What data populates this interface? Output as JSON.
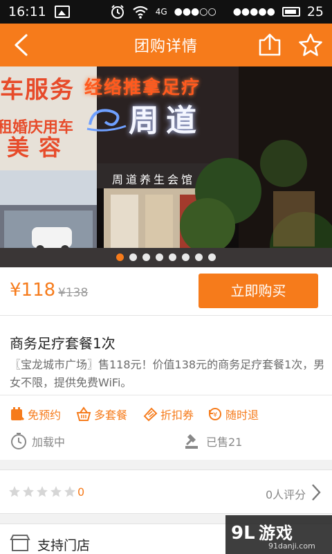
{
  "status_bar": {
    "time": "16:11",
    "network": "4G",
    "signal_dots": "●●●○○",
    "signal_dots_2": "●●●●●",
    "battery": "25"
  },
  "header": {
    "title": "团购详情",
    "icons": [
      "back-arrow-icon",
      "share-icon",
      "star-icon"
    ],
    "bg_color": "#f67b1b"
  },
  "banner": {
    "signs": {
      "top": "经络推拿足疗",
      "brand": "周道",
      "left1": "车服务",
      "left2": "租婚庆用车",
      "left3": "美容",
      "entrance": "周道养生会馆"
    },
    "slide_count": 8,
    "active_index": 0
  },
  "price": {
    "current": "¥118",
    "original": "¥138",
    "buy_label": "立即购买"
  },
  "deal": {
    "title": "商务足疗套餐1次",
    "description": "〖宝龙城市广场〗售118元！价值138元的商务足疗套餐1次，男女不限，提供免费WiFi。"
  },
  "features": [
    {
      "label": "免预约",
      "icon": "calendar-icon"
    },
    {
      "label": "多套餐",
      "icon": "basket-icon"
    },
    {
      "label": "折扣券",
      "icon": "coupon-icon"
    },
    {
      "label": "随时退",
      "icon": "refund-icon"
    }
  ],
  "meta": {
    "countdown": "加载中",
    "sold": "已售21"
  },
  "rating": {
    "stars": 0,
    "score": "0",
    "reviews": "0人评分"
  },
  "store": {
    "label": "支持门店"
  },
  "watermark": {
    "brand": "游戏",
    "prefix": "9L",
    "site": "91danji.com"
  }
}
